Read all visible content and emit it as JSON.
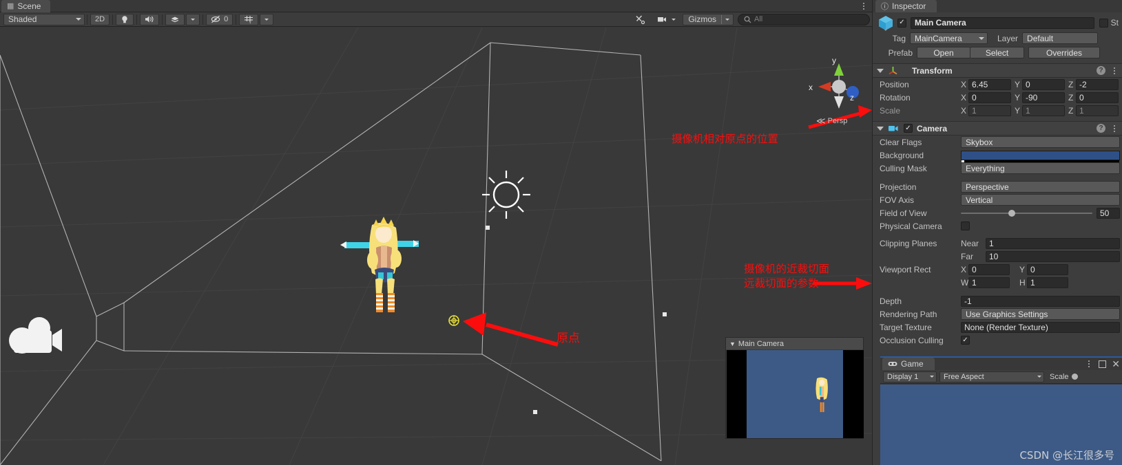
{
  "scene_panel": {
    "tab": {
      "label": "Scene",
      "icon": "grid-icon"
    },
    "toolbar": {
      "shading_mode": "Shaded",
      "mode_2d": "2D",
      "lighting_icon": "lightbulb-icon",
      "audio_icon": "speaker-icon",
      "fx_icon": "effects-icon",
      "hidden_count": "0",
      "hidden_icon": "eye-slash-icon",
      "grid_icon": "grid-visibility-icon",
      "tools_icon": "tools-icon",
      "camera_icon": "scene-camera-icon",
      "gizmos_label": "Gizmos",
      "search_placeholder": "All",
      "search_icon": "search-icon"
    },
    "gizmo": {
      "axis_y": "y",
      "axis_x": "x",
      "axis_z": "z",
      "projection_label": "Persp"
    },
    "annotations": [
      {
        "id": "position-note",
        "text": "摄像机相对原点的位置"
      },
      {
        "id": "clipping-note-line1",
        "text": "摄像机的近裁切面"
      },
      {
        "id": "clipping-note-line2",
        "text": "远裁切面的参数"
      },
      {
        "id": "origin-note",
        "text": "原点"
      }
    ],
    "camera_preview": {
      "title": "Main Camera",
      "foldout_icon": "triangle-down-icon"
    }
  },
  "inspector": {
    "tab": {
      "label": "Inspector",
      "icon": "info-icon"
    },
    "object": {
      "name": "Main Camera",
      "enabled": true,
      "icon": "prefab-cube-icon",
      "static_label": "St",
      "tag_label": "Tag",
      "tag_value": "MainCamera",
      "layer_label": "Layer",
      "layer_value": "Default",
      "prefab_label": "Prefab",
      "open_button": "Open",
      "select_button": "Select",
      "overrides_button": "Overrides"
    },
    "transform": {
      "title": "Transform",
      "icon": "transform-axis-icon",
      "rows": [
        {
          "label": "Position",
          "x": "6.45",
          "y": "0",
          "z": "-2",
          "disabled": false
        },
        {
          "label": "Rotation",
          "x": "0",
          "y": "-90",
          "z": "0",
          "disabled": false
        },
        {
          "label": "Scale",
          "x": "1",
          "y": "1",
          "z": "1",
          "disabled": true
        }
      ],
      "axis_labels": [
        "X",
        "Y",
        "Z"
      ]
    },
    "camera": {
      "title": "Camera",
      "icon": "camera-icon",
      "enabled": true,
      "clear_flags_label": "Clear Flags",
      "clear_flags_value": "Skybox",
      "background_label": "Background",
      "background_color": "#2f5087",
      "culling_mask_label": "Culling Mask",
      "culling_mask_value": "Everything",
      "projection_label": "Projection",
      "projection_value": "Perspective",
      "fov_axis_label": "FOV Axis",
      "fov_axis_value": "Vertical",
      "field_of_view_label": "Field of View",
      "field_of_view_value": "50",
      "field_of_view_percent": 36,
      "physical_camera_label": "Physical Camera",
      "physical_camera_checked": false,
      "clipping_planes_label": "Clipping Planes",
      "near_label": "Near",
      "near_value": "1",
      "far_label": "Far",
      "far_value": "10",
      "viewport_rect_label": "Viewport Rect",
      "viewport_x_label": "X",
      "viewport_x": "0",
      "viewport_y_label": "Y",
      "viewport_y": "0",
      "viewport_w_label": "W",
      "viewport_w": "1",
      "viewport_h_label": "H",
      "viewport_h": "1",
      "depth_label": "Depth",
      "depth_value": "-1",
      "rendering_path_label": "Rendering Path",
      "rendering_path_value": "Use Graphics Settings",
      "target_texture_label": "Target Texture",
      "target_texture_value": "None (Render Texture)",
      "occlusion_culling_label": "Occlusion Culling",
      "occlusion_culling_checked": true
    }
  },
  "game_panel": {
    "tab": {
      "label": "Game",
      "icon": "gamepad-icon"
    },
    "toolbar": {
      "display_value": "Display 1",
      "aspect_value": "Free Aspect",
      "scale_label": "Scale"
    },
    "window_buttons": {
      "kebab": "more-options-icon",
      "maximize": "maximize-icon",
      "close": "close-icon"
    },
    "watermark": "CSDN @长江很多号"
  }
}
